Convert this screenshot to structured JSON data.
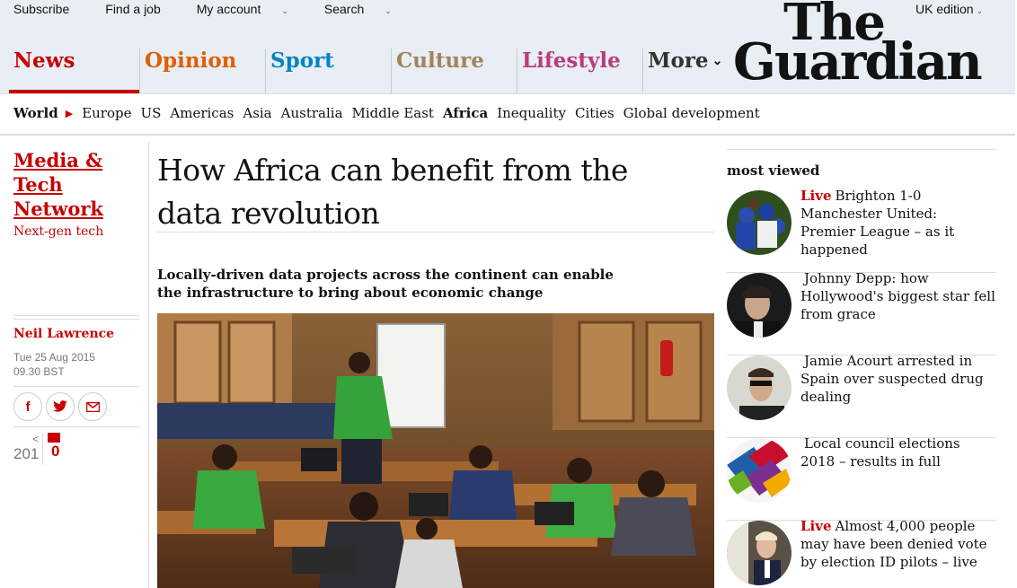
{
  "top_links": [
    {
      "label": "Subscribe",
      "chevron": false
    },
    {
      "label": "Find a job",
      "chevron": false
    },
    {
      "label": "My account",
      "chevron": true
    },
    {
      "label": "Search",
      "chevron": true
    }
  ],
  "edition": "UK edition",
  "logo": {
    "line1": "The",
    "line2": "Guardian"
  },
  "pillars": [
    {
      "label": "News",
      "color": "#c70000"
    },
    {
      "label": "Opinion",
      "color": "#e05e00"
    },
    {
      "label": "Sport",
      "color": "#0084c6"
    },
    {
      "label": "Culture",
      "color": "#a1845c"
    },
    {
      "label": "Lifestyle",
      "color": "#bb3b80"
    },
    {
      "label": "More",
      "color": "#121212"
    }
  ],
  "subnav": {
    "section": "World",
    "items": [
      "Europe",
      "US",
      "Americas",
      "Asia",
      "Australia",
      "Middle East",
      "Africa",
      "Inequality",
      "Cities",
      "Global development"
    ],
    "active": "Africa"
  },
  "series": {
    "title": "Media & Tech Network",
    "subtitle": "Next-gen tech"
  },
  "article": {
    "headline": "How Africa can benefit from the data revolution",
    "standfirst": "Locally-driven data projects across the continent can enable the infrastructure to bring about economic change",
    "author": "Neil Lawrence",
    "date": "Tue 25 Aug 2015",
    "time": "09.30 BST",
    "share_count": "201",
    "comment_count": "0"
  },
  "share_buttons": [
    {
      "icon": "facebook-icon",
      "glyph": "f"
    },
    {
      "icon": "twitter-icon",
      "glyph": "🐦"
    },
    {
      "icon": "email-icon",
      "glyph": "✉"
    }
  ],
  "most_viewed": {
    "title": "most viewed",
    "items": [
      {
        "live": "Live",
        "text": "Brighton 1-0 Manchester United: Premier League – as it happened"
      },
      {
        "live": "",
        "text": "Johnny Depp: how Hollywood's biggest star fell from grace"
      },
      {
        "live": "",
        "text": "Jamie Acourt arrested in Spain over suspected drug dealing"
      },
      {
        "live": "",
        "text": "Local council elections 2018 – results in full"
      },
      {
        "live": "Live",
        "text": "Almost 4,000 people may have been denied vote by election ID pilots – live"
      }
    ]
  }
}
